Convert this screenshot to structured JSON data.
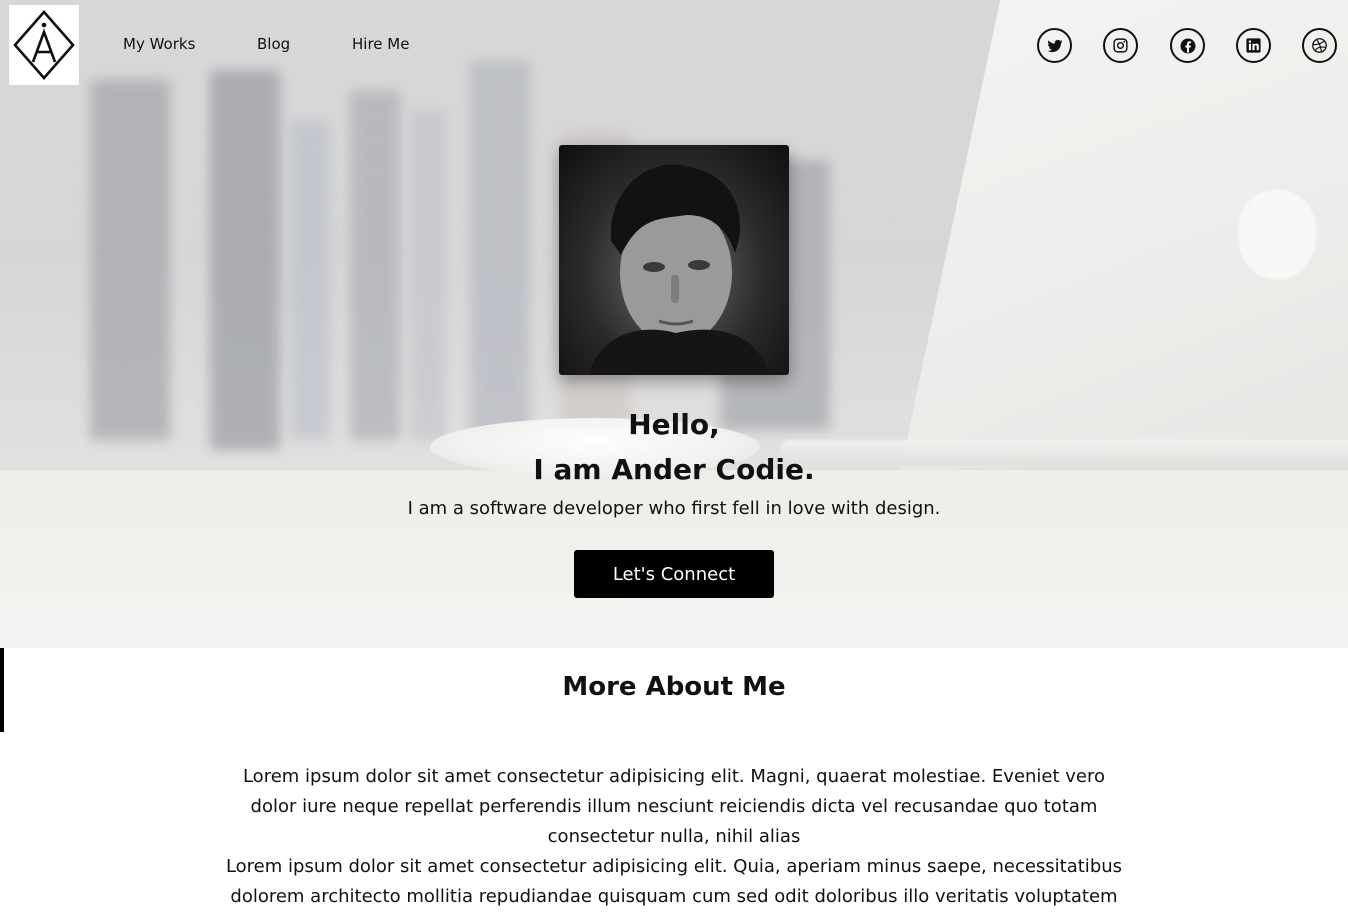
{
  "nav": {
    "logo_alt": "Logo",
    "links": [
      "My Works",
      "Blog",
      "Hire Me"
    ]
  },
  "social": {
    "icons": [
      "twitter-icon",
      "instagram-icon",
      "facebook-icon",
      "linkedin-icon",
      "dribbble-icon"
    ]
  },
  "hero": {
    "greeting": "Hello,",
    "name_line": "I am Ander Codie.",
    "tagline": "I am a software developer who first fell in love with design.",
    "cta_label": "Let's Connect"
  },
  "about": {
    "title": "More About Me",
    "paragraph1": "Lorem ipsum dolor sit amet consectetur adipisicing elit. Magni, quaerat molestiae. Eveniet vero dolor iure neque repellat perferendis illum nesciunt reiciendis dicta vel recusandae quo totam consectetur nulla, nihil alias",
    "paragraph2": "Lorem ipsum dolor sit amet consectetur adipisicing elit. Quia, aperiam minus saepe, necessitatibus dolorem architecto mollitia repudiandae quisquam cum sed odit doloribus illo veritatis voluptatem"
  },
  "colors": {
    "accent": "#000000",
    "text": "#111111",
    "button_text": "#ffffff"
  }
}
